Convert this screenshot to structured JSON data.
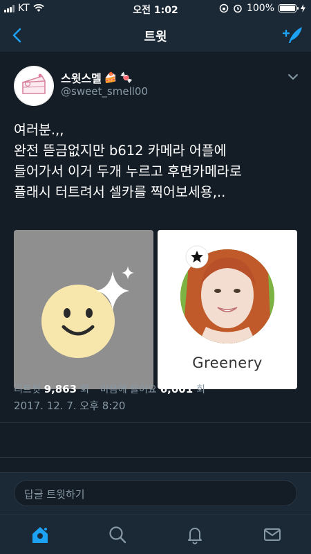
{
  "status_bar": {
    "carrier": "KT",
    "time": "오전 1:02",
    "battery": "100%"
  },
  "nav": {
    "title": "트윗",
    "back_icon": "back-chevron-icon",
    "compose_icon": "compose-tweet-icon"
  },
  "tweet": {
    "display_name": "스윗스멜",
    "display_name_emojis": [
      "🍰",
      "🍬"
    ],
    "username": "@sweet_smell00",
    "text_lines": [
      "여러분.,,",
      "완전 뜯금없지만 b612 카메라 어플에",
      "들어가서 이거 두개 누르고 후면카메라로",
      "플래시 터트려서 셀카를 찍어보세용,.."
    ],
    "media": {
      "right_label": "Greenery"
    },
    "timestamp": "2017. 12. 7. 오후 8:20",
    "stats": {
      "retweets_label": "리트윗",
      "retweets_count": "9,863",
      "retweets_unit": "회",
      "likes_label": "마음에 들어요",
      "likes_count": "6,001",
      "likes_unit": "회"
    }
  },
  "reply": {
    "placeholder": "답글 트윗하기"
  },
  "tabs": [
    {
      "icon": "home-icon",
      "active": true
    },
    {
      "icon": "search-icon",
      "active": false
    },
    {
      "icon": "notifications-icon",
      "active": false
    },
    {
      "icon": "messages-icon",
      "active": false
    }
  ],
  "colors": {
    "background": "#141d26",
    "bar": "#1b2836",
    "accent": "#1da1f2",
    "muted": "#8899a6"
  }
}
